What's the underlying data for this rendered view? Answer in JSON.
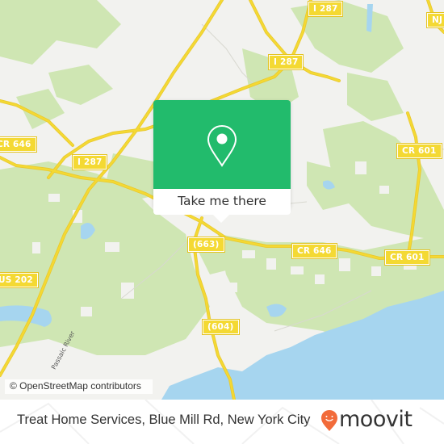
{
  "map": {
    "road_labels": [
      {
        "id": "i287-top",
        "text": "I 287"
      },
      {
        "id": "i287-mid",
        "text": "I 287"
      },
      {
        "id": "i287-left",
        "text": "I 287"
      },
      {
        "id": "nj",
        "text": "NJ"
      },
      {
        "id": "cr646-left",
        "text": "CR 646"
      },
      {
        "id": "cr601-upper",
        "text": "CR 601"
      },
      {
        "id": "cr601-lower",
        "text": "CR 601"
      },
      {
        "id": "cr646-right",
        "text": "CR 646"
      },
      {
        "id": "r663",
        "text": "(663)"
      },
      {
        "id": "r604",
        "text": "(604)"
      },
      {
        "id": "us202",
        "text": "US 202"
      }
    ],
    "water_labels": [
      {
        "id": "passaic-river",
        "text": "Passaic River"
      }
    ],
    "attribution": "© OpenStreetMap contributors",
    "colors": {
      "land": "#f2f2ef",
      "green": "#cfe6b3",
      "water": "#a6d5ef",
      "road": "#f4d933",
      "accent": "#22bb6c"
    }
  },
  "popup": {
    "icon": "location-pin-icon",
    "button_label": "Take me there"
  },
  "footer": {
    "title": "Treat Home Services, Blue Mill Rd, New York City",
    "brand": "moovit",
    "brand_color": "#f26b3a"
  }
}
